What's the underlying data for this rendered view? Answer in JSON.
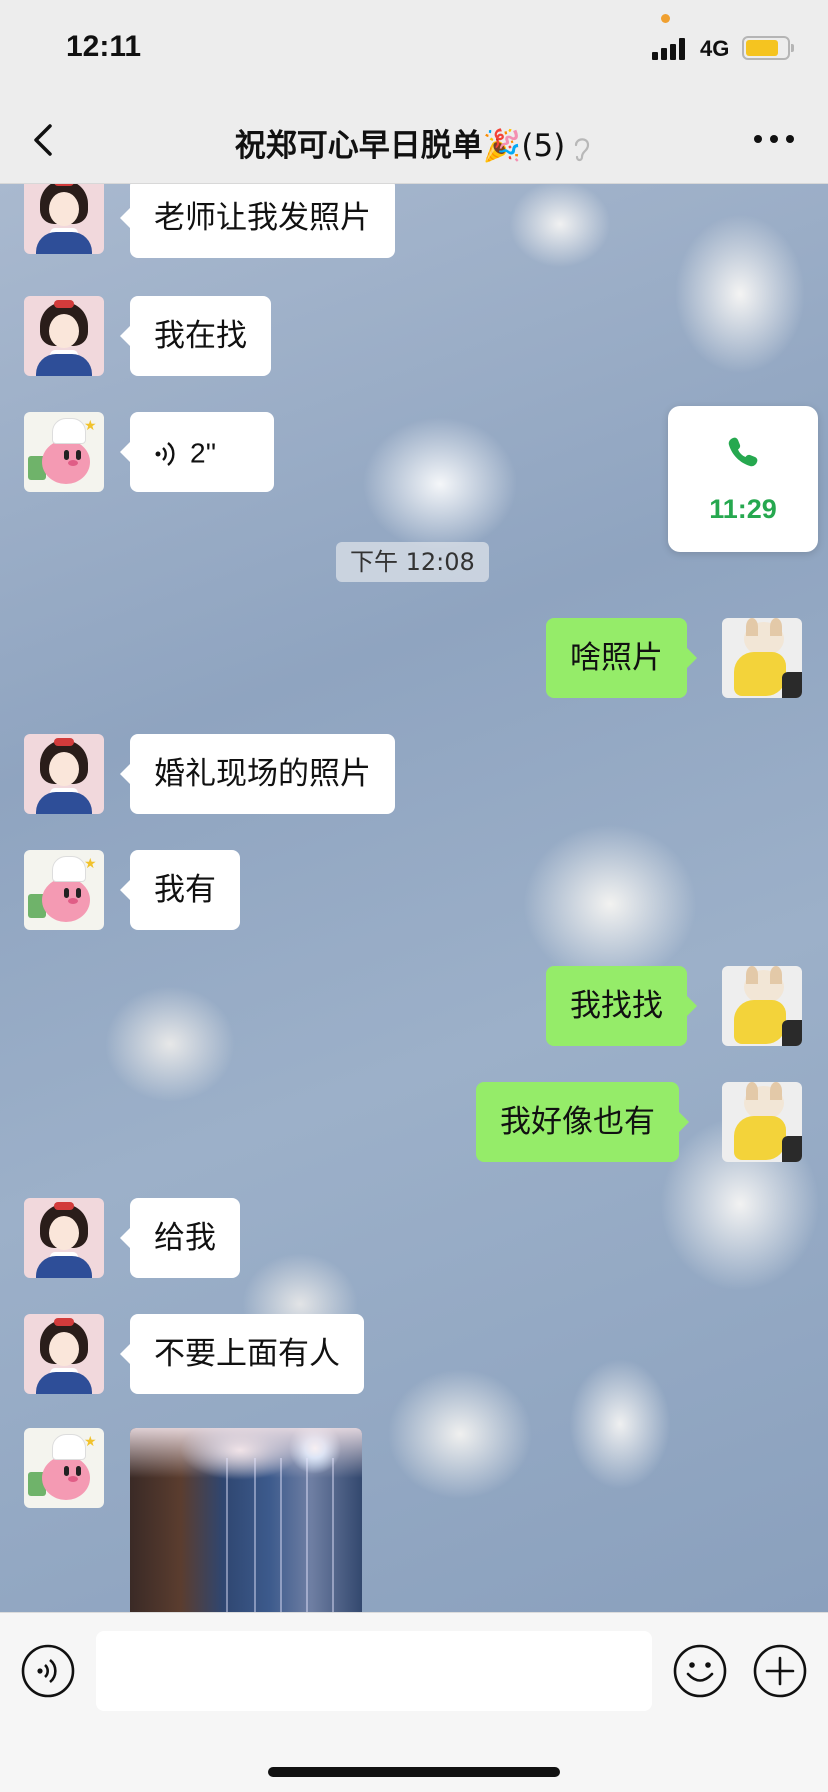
{
  "status_bar": {
    "time": "12:11",
    "network": "4G",
    "battery_color": "#f5c420"
  },
  "nav": {
    "title": "祝郑可心早日脱单🎉",
    "member_count": "(5)"
  },
  "timestamp": "下午 12:08",
  "call_card": {
    "time": "11:29",
    "accent": "#26a84f"
  },
  "messages": [
    {
      "side": "left",
      "avatar": "snow-white-avatar",
      "text": "老师让我发照片"
    },
    {
      "side": "left",
      "avatar": "snow-white-avatar",
      "text": "我在找"
    },
    {
      "side": "left",
      "avatar": "kirby-avatar",
      "type": "voice",
      "duration": "2''"
    },
    {
      "side": "right",
      "avatar": "dog-avatar",
      "text": "啥照片"
    },
    {
      "side": "left",
      "avatar": "snow-white-avatar",
      "text": "婚礼现场的照片"
    },
    {
      "side": "left",
      "avatar": "kirby-avatar",
      "text": "我有"
    },
    {
      "side": "right",
      "avatar": "dog-avatar",
      "text": "我找找"
    },
    {
      "side": "right",
      "avatar": "dog-avatar",
      "text": "我好像也有"
    },
    {
      "side": "left",
      "avatar": "snow-white-avatar",
      "text": "给我"
    },
    {
      "side": "left",
      "avatar": "snow-white-avatar",
      "text": "不要上面有人"
    },
    {
      "side": "left",
      "avatar": "kirby-avatar",
      "type": "image"
    }
  ],
  "colors": {
    "sent_bubble": "#95ec69",
    "received_bubble": "#ffffff"
  },
  "input": {
    "value": "",
    "placeholder": ""
  }
}
